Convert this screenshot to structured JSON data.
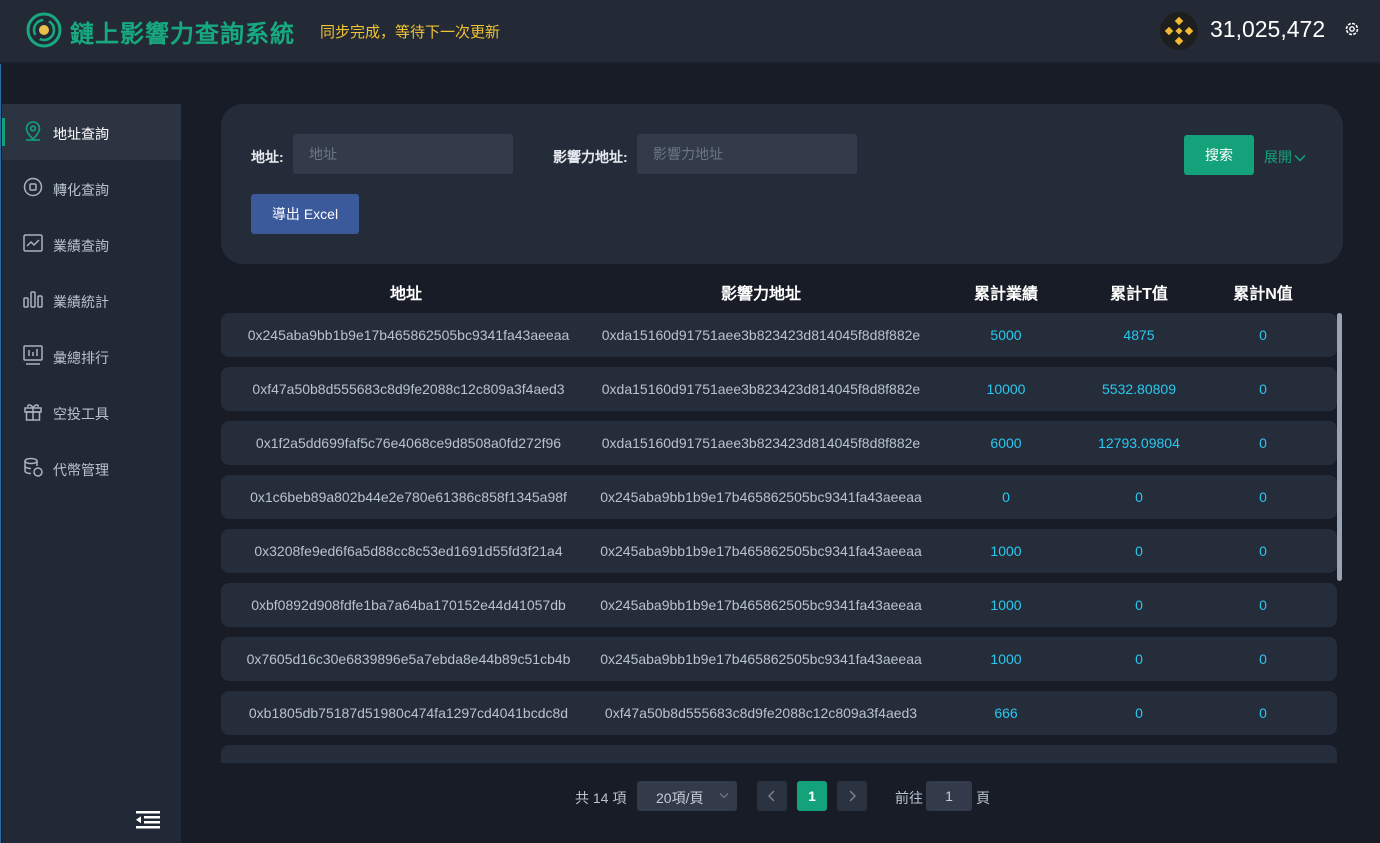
{
  "header": {
    "title": "鏈上影響力查詢系統",
    "sync_status": "同步完成，等待下一次更新",
    "balance": "31,025,472"
  },
  "sidebar": {
    "items": [
      {
        "label": "地址查詢",
        "icon": "location-pin-icon",
        "active": true
      },
      {
        "label": "轉化查詢",
        "icon": "exchange-icon",
        "active": false
      },
      {
        "label": "業績查詢",
        "icon": "trend-chart-icon",
        "active": false
      },
      {
        "label": "業績統計",
        "icon": "bar-chart-icon",
        "active": false
      },
      {
        "label": "彙總排行",
        "icon": "ranking-icon",
        "active": false
      },
      {
        "label": "空投工具",
        "icon": "gift-icon",
        "active": false
      },
      {
        "label": "代幣管理",
        "icon": "coins-icon",
        "active": false
      }
    ]
  },
  "search": {
    "address_label": "地址:",
    "address_placeholder": "地址",
    "influence_label": "影響力地址:",
    "influence_placeholder": "影響力地址",
    "search_button": "搜索",
    "expand_label": "展開",
    "export_button": "導出 Excel"
  },
  "table": {
    "columns": [
      "地址",
      "影響力地址",
      "累計業績",
      "累計T值",
      "累計N值"
    ],
    "rows": [
      {
        "address": "0x245aba9bb1b9e17b465862505bc9341fa43aeeaa",
        "influence": "0xda15160d91751aee3b823423d814045f8d8f882e",
        "perf": "5000",
        "t": "4875",
        "n": "0"
      },
      {
        "address": "0xf47a50b8d555683c8d9fe2088c12c809a3f4aed3",
        "influence": "0xda15160d91751aee3b823423d814045f8d8f882e",
        "perf": "10000",
        "t": "5532.80809",
        "n": "0"
      },
      {
        "address": "0x1f2a5dd699faf5c76e4068ce9d8508a0fd272f96",
        "influence": "0xda15160d91751aee3b823423d814045f8d8f882e",
        "perf": "6000",
        "t": "12793.09804",
        "n": "0"
      },
      {
        "address": "0x1c6beb89a802b44e2e780e61386c858f1345a98f",
        "influence": "0x245aba9bb1b9e17b465862505bc9341fa43aeeaa",
        "perf": "0",
        "t": "0",
        "n": "0"
      },
      {
        "address": "0x3208fe9ed6f6a5d88cc8c53ed1691d55fd3f21a4",
        "influence": "0x245aba9bb1b9e17b465862505bc9341fa43aeeaa",
        "perf": "1000",
        "t": "0",
        "n": "0"
      },
      {
        "address": "0xbf0892d908fdfe1ba7a64ba170152e44d41057db",
        "influence": "0x245aba9bb1b9e17b465862505bc9341fa43aeeaa",
        "perf": "1000",
        "t": "0",
        "n": "0"
      },
      {
        "address": "0x7605d16c30e6839896e5a7ebda8e44b89c51cb4b",
        "influence": "0x245aba9bb1b9e17b465862505bc9341fa43aeeaa",
        "perf": "1000",
        "t": "0",
        "n": "0"
      },
      {
        "address": "0xb1805db75187d51980c474fa1297cd4041bcdc8d",
        "influence": "0xf47a50b8d555683c8d9fe2088c12c809a3f4aed3",
        "perf": "666",
        "t": "0",
        "n": "0"
      }
    ]
  },
  "pagination": {
    "total": "共 14 項",
    "page_size": "20項/頁",
    "current_page": "1",
    "goto_label": "前往",
    "goto_value": "1",
    "goto_suffix": "頁"
  },
  "colors": {
    "accent": "#14a27b",
    "number": "#29c8f0",
    "warning": "#f1c232",
    "export": "#3a5a9c"
  }
}
